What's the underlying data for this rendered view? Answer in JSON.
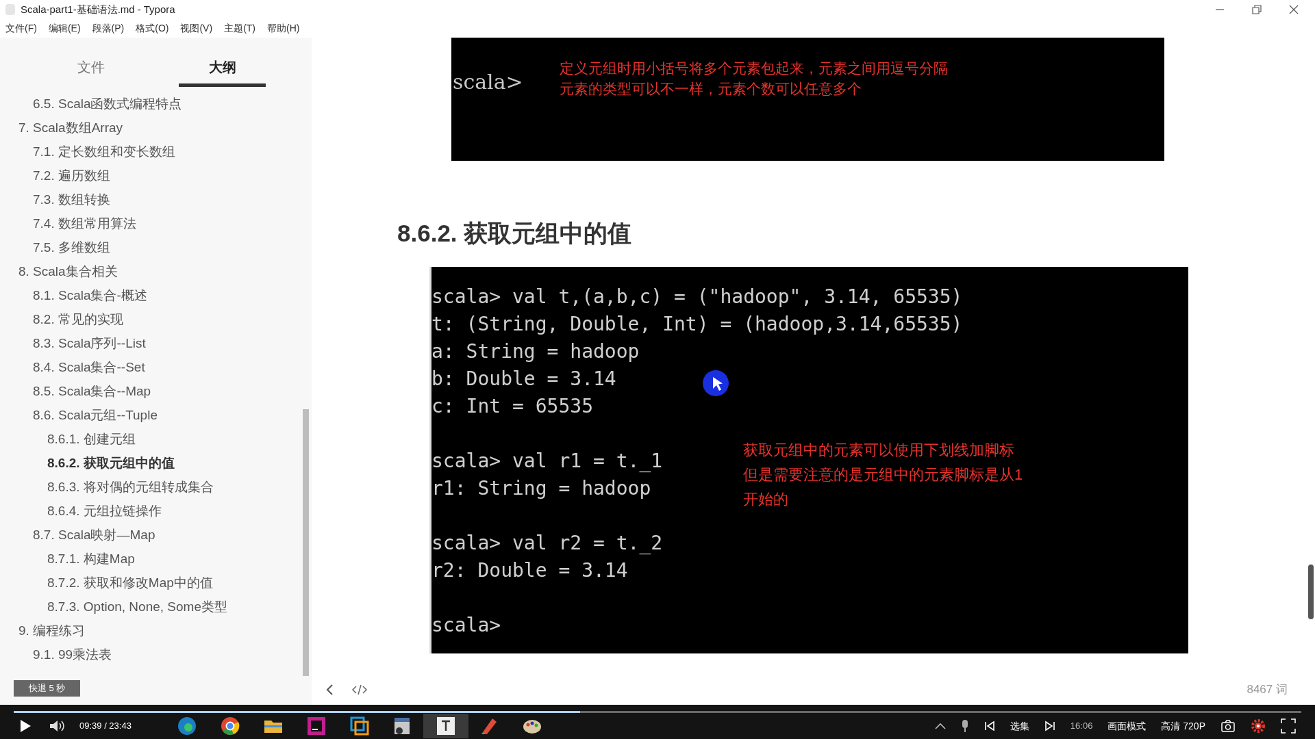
{
  "window": {
    "title": "Scala-part1-基础语法.md - Typora"
  },
  "menu": [
    "文件(F)",
    "编辑(E)",
    "段落(P)",
    "格式(O)",
    "视图(V)",
    "主题(T)",
    "帮助(H)"
  ],
  "sidebar": {
    "tabs": [
      {
        "label": "文件",
        "selected": false
      },
      {
        "label": "大纲",
        "selected": true
      }
    ],
    "outline_continued": [
      {
        "label": "6.5. Scala函数式编程特点",
        "selected": false
      }
    ],
    "outline": [
      {
        "label": "7. Scala数组Array",
        "selected": false,
        "children": [
          {
            "label": "7.1. 定长数组和变长数组",
            "selected": false
          },
          {
            "label": "7.2. 遍历数组",
            "selected": false
          },
          {
            "label": "7.3. 数组转换",
            "selected": false
          },
          {
            "label": "7.4. 数组常用算法",
            "selected": false
          },
          {
            "label": "7.5. 多维数组",
            "selected": false
          }
        ]
      },
      {
        "label": "8. Scala集合相关",
        "selected": false,
        "children": [
          {
            "label": "8.1. Scala集合-概述",
            "selected": false
          },
          {
            "label": "8.2. 常见的实现",
            "selected": false
          },
          {
            "label": "8.3. Scala序列--List",
            "selected": false
          },
          {
            "label": "8.4. Scala集合--Set",
            "selected": false
          },
          {
            "label": "8.5. Scala集合--Map",
            "selected": false
          },
          {
            "label": "8.6. Scala元组--Tuple",
            "selected": false,
            "children": [
              {
                "label": "8.6.1. 创建元组",
                "selected": false
              },
              {
                "label": "8.6.2. 获取元组中的值",
                "selected": true
              },
              {
                "label": "8.6.3. 将对偶的元组转成集合",
                "selected": false
              },
              {
                "label": "8.6.4. 元组拉链操作",
                "selected": false
              }
            ]
          },
          {
            "label": "8.7. Scala映射—Map",
            "selected": false,
            "children": [
              {
                "label": "8.7.1. 构建Map",
                "selected": false
              },
              {
                "label": "8.7.2. 获取和修改Map中的值",
                "selected": false
              },
              {
                "label": "8.7.3. Option, None, Some类型",
                "selected": false
              }
            ]
          }
        ]
      },
      {
        "label": "9. 编程练习",
        "selected": false,
        "children": [
          {
            "label": "9.1. 99乘法表",
            "selected": false
          }
        ]
      }
    ]
  },
  "editor": {
    "terminal_1": {
      "prompt": "scala>",
      "notes": [
        "定义元组时用小括号将多个元素包起来，元素之间用逗号分隔",
        "元素的类型可以不一样，元素个数可以任意多个"
      ]
    },
    "heading": "8.6.2. 获取元组中的值",
    "terminal_2": {
      "blocks": [
        [
          "scala> val t,(a,b,c) = (\"hadoop\", 3.14, 65535)",
          "t: (String, Double, Int) = (hadoop,3.14,65535)",
          "a: String = hadoop",
          "b: Double = 3.14",
          "c: Int = 65535"
        ],
        [
          "scala> val r1 = t._1",
          "r1: String = hadoop"
        ],
        [
          "scala> val r2 = t._2",
          "r2: Double = 3.14"
        ],
        [
          "scala>"
        ]
      ],
      "notes": [
        "获取元组中的元素可以使用下划线加脚标",
        "但是需要注意的是元组中的元素脚标是从1",
        "开始的"
      ]
    },
    "word_count": "8467 词"
  },
  "player": {
    "toast": "快退 5 秒",
    "time": "09:39 / 23:43",
    "level": 0.44,
    "buttons": [
      "选集",
      "画面模式",
      "高清 720P"
    ],
    "clock": "16:06"
  }
}
